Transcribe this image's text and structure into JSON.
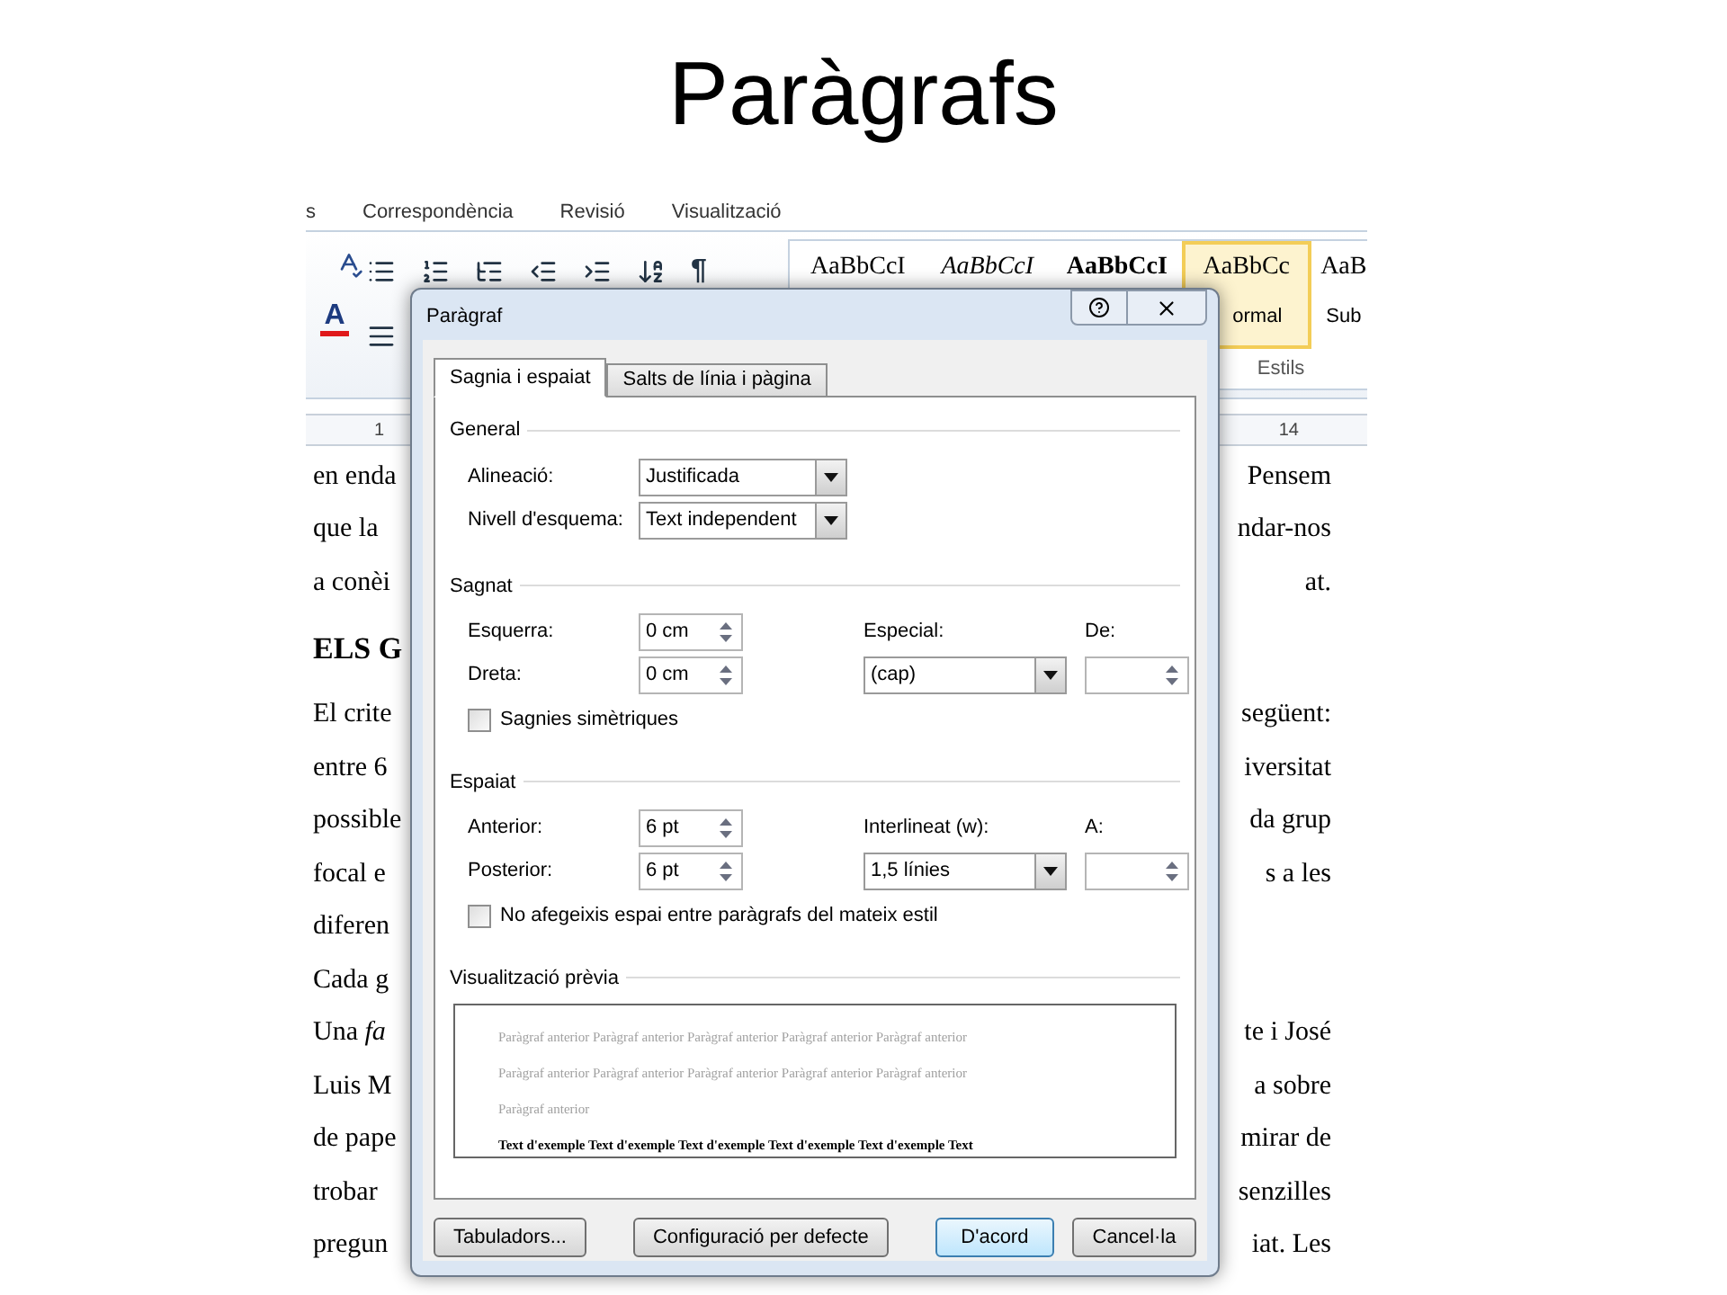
{
  "slide": {
    "title": "Paràgrafs"
  },
  "ribbon": {
    "tabs": [
      "s",
      "Correspondència",
      "Revisió",
      "Visualització"
    ],
    "pilcrow": "¶",
    "font_color_letter": "A",
    "styles": [
      {
        "sample": "AaBbCcI",
        "selected": false,
        "kind": "plain"
      },
      {
        "sample": "AaBbCcI",
        "selected": false,
        "kind": "italic"
      },
      {
        "sample": "AaBbCcI",
        "selected": false,
        "kind": "bold"
      },
      {
        "sample": "AaBbCc",
        "name": "ormal",
        "selected": true,
        "kind": "plain"
      },
      {
        "sample": "AaB",
        "name": "Sub",
        "selected": false,
        "kind": "plain"
      }
    ],
    "group_label": "Estils"
  },
  "ruler": {
    "marks": [
      "1",
      "14"
    ]
  },
  "document": {
    "lines": [
      {
        "kind": "text",
        "left": "en enda",
        "right": "Pensem"
      },
      {
        "kind": "text",
        "left": "que la",
        "right": "ndar-nos"
      },
      {
        "kind": "text",
        "left": "a conèi",
        "right": "at."
      },
      {
        "kind": "heading",
        "left": "ELS G"
      },
      {
        "kind": "text",
        "left": "El crite",
        "right": "següent:"
      },
      {
        "kind": "text",
        "left": "entre 6",
        "right": "iversitat"
      },
      {
        "kind": "text",
        "left": "possible",
        "right": "da grup"
      },
      {
        "kind": "text",
        "left": "focal e",
        "right": "s a les"
      },
      {
        "kind": "text",
        "left": "diferen"
      },
      {
        "kind": "text",
        "left": "Cada g"
      },
      {
        "kind": "text",
        "left": "Una *fa*",
        "right": "te i José"
      },
      {
        "kind": "text",
        "left": "Luis M",
        "right": "a sobre"
      },
      {
        "kind": "text",
        "left": "de pape",
        "right": "mirar de"
      },
      {
        "kind": "text",
        "left": "trobar",
        "right": "senzilles"
      },
      {
        "kind": "text",
        "left": "pregun",
        "right": "iat. Les"
      }
    ]
  },
  "dialog": {
    "title": "Paràgraf",
    "tabs": [
      {
        "label": "Sagnia i espaiat",
        "selected": true
      },
      {
        "label": "Salts de línia i pàgina",
        "selected": false
      }
    ],
    "sections": [
      {
        "title": "General",
        "left": [
          {
            "label": "Alineació:",
            "kind": "dropdown",
            "value": "Justificada"
          },
          {
            "label": "Nivell d'esquema:",
            "kind": "dropdown",
            "value": "Text independent"
          }
        ]
      },
      {
        "title": "Sagnat",
        "left": [
          {
            "label": "Esquerra:",
            "kind": "spinner",
            "value": "0 cm"
          },
          {
            "label": "Dreta:",
            "kind": "spinner",
            "value": "0 cm"
          }
        ],
        "right": [
          {
            "label": "Especial:",
            "kind": "dropdown",
            "value": "(cap)"
          },
          {
            "label": "De:",
            "kind": "spinner"
          }
        ],
        "checkbox": {
          "label": "Sagnies simètriques",
          "checked": false
        }
      },
      {
        "title": "Espaiat",
        "left": [
          {
            "label": "Anterior:",
            "kind": "spinner",
            "value": "6 pt"
          },
          {
            "label": "Posterior:",
            "kind": "spinner",
            "value": "6 pt"
          }
        ],
        "right": [
          {
            "label": "Interlineat (w):",
            "kind": "dropdown",
            "value": "1,5 línies"
          },
          {
            "label": "A:",
            "kind": "spinner"
          }
        ],
        "checkbox": {
          "label": "No afegeixis espai entre paràgrafs del mateix estil",
          "checked": false
        }
      }
    ],
    "preview": {
      "title": "Visualització prèvia",
      "previous_lines": [
        "Paràgraf anterior Paràgraf anterior Paràgraf anterior Paràgraf anterior Paràgraf anterior",
        "Paràgraf anterior Paràgraf anterior Paràgraf anterior Paràgraf anterior Paràgraf anterior",
        "Paràgraf anterior"
      ],
      "sample_line": "Text d'exemple Text d'exemple Text d'exemple Text d'exemple Text d'exemple Text"
    },
    "buttons": [
      {
        "label": "Tabuladors...",
        "default": false
      },
      {
        "label": "Configuració per defecte",
        "default": false
      },
      {
        "label": "D'acord",
        "default": true
      },
      {
        "label": "Cancel·la",
        "default": false
      }
    ]
  }
}
